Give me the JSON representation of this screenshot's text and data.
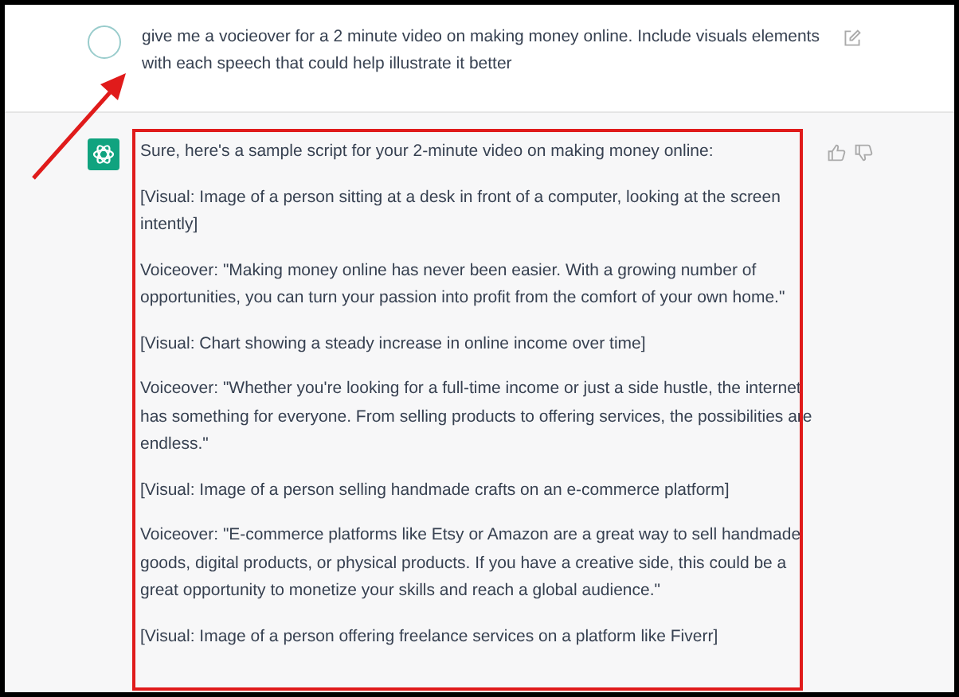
{
  "user_message": {
    "text": "give me a vocieover for a 2 minute video on making money online. Include visuals elements with each speech that could help illustrate it better"
  },
  "assistant_message": {
    "paragraphs": [
      "Sure, here's a sample script for your 2-minute video on making money online:",
      "[Visual: Image of a person sitting at a desk in front of a computer, looking at the screen intently]",
      "Voiceover: \"Making money online has never been easier. With a growing number of opportunities, you can turn your passion into profit from the comfort of your own home.\"",
      "[Visual: Chart showing a steady increase in online income over time]",
      "Voiceover: \"Whether you're looking for a full-time income or just a side hustle, the internet has something for everyone. From selling products to offering services, the possibilities are endless.\"",
      "[Visual: Image of a person selling handmade crafts on an e-commerce platform]",
      "Voiceover: \"E-commerce platforms like Etsy or Amazon are a great way to sell handmade goods, digital products, or physical products. If you have a creative side, this could be a great opportunity to monetize your skills and reach a global audience.\"",
      "[Visual: Image of a person offering freelance services on a platform like Fiverr]"
    ]
  }
}
